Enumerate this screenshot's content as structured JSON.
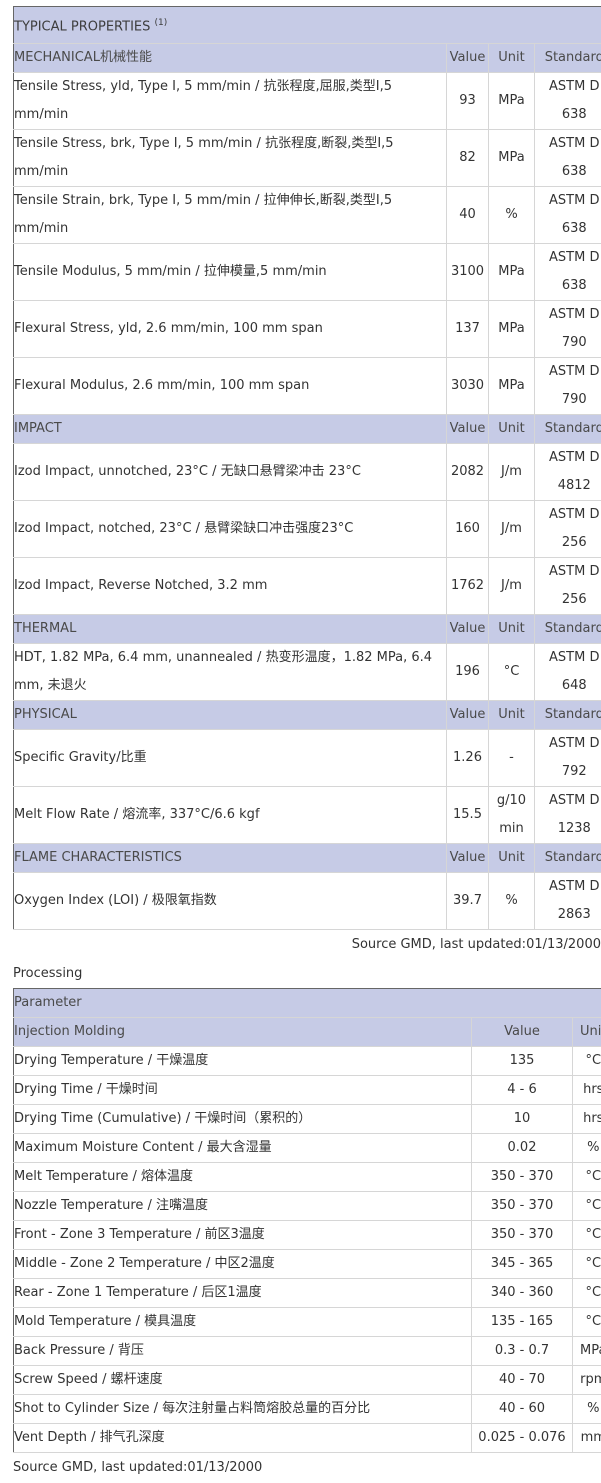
{
  "properties": {
    "title": "TYPICAL PROPERTIES",
    "footnote": "(1)",
    "sections": [
      {
        "name": "MECHANICAL机械性能",
        "value_h": "Value",
        "unit_h": "Unit",
        "std_h": "Standard",
        "rows": [
          {
            "name": "Tensile Stress, yld, Type I, 5 mm/min / 抗张程度,屈服,类型I,5 mm/min",
            "value": "93",
            "unit": "MPa",
            "std1": "ASTM D",
            "std2": "638"
          },
          {
            "name": "Tensile Stress, brk, Type I, 5 mm/min / 抗张程度,断裂,类型I,5 mm/min",
            "value": "82",
            "unit": "MPa",
            "std1": "ASTM D",
            "std2": "638"
          },
          {
            "name": "Tensile Strain, brk, Type I, 5 mm/min / 拉伸伸长,断裂,类型I,5 mm/min",
            "value": "40",
            "unit": "%",
            "std1": "ASTM D",
            "std2": "638"
          },
          {
            "name": "Tensile Modulus, 5 mm/min / 拉伸模量,5 mm/min",
            "value": "3100",
            "unit": "MPa",
            "std1": "ASTM D",
            "std2": "638"
          },
          {
            "name": "Flexural Stress, yld, 2.6 mm/min, 100 mm span",
            "value": "137",
            "unit": "MPa",
            "std1": "ASTM D",
            "std2": "790"
          },
          {
            "name": "Flexural Modulus, 2.6 mm/min, 100 mm span",
            "value": "3030",
            "unit": "MPa",
            "std1": "ASTM D",
            "std2": "790"
          }
        ]
      },
      {
        "name": "IMPACT",
        "value_h": "Value",
        "unit_h": "Unit",
        "std_h": "Standard",
        "rows": [
          {
            "name": "Izod Impact, unnotched, 23°C / 无缺口悬臂梁冲击 23°C",
            "value": "2082",
            "unit": "J/m",
            "std1": "ASTM D",
            "std2": "4812"
          },
          {
            "name": "Izod Impact, notched, 23°C / 悬臂梁缺口冲击强度23°C",
            "value": "160",
            "unit": "J/m",
            "std1": "ASTM D",
            "std2": "256"
          },
          {
            "name": "Izod Impact, Reverse Notched, 3.2 mm",
            "value": "1762",
            "unit": "J/m",
            "std1": "ASTM D",
            "std2": "256"
          }
        ]
      },
      {
        "name": "THERMAL",
        "value_h": "Value",
        "unit_h": "Unit",
        "std_h": "Standard",
        "rows": [
          {
            "name": "HDT, 1.82 MPa, 6.4 mm, unannealed / 热变形温度，1.82 MPa, 6.4 mm, 未退火",
            "value": "196",
            "unit": "°C",
            "std1": "ASTM D",
            "std2": "648"
          }
        ]
      },
      {
        "name": "PHYSICAL",
        "value_h": "Value",
        "unit_h": "Unit",
        "std_h": "Standard",
        "rows": [
          {
            "name": "Specific Gravity/比重",
            "value": "1.26",
            "unit": "-",
            "std1": "ASTM D",
            "std2": "792"
          },
          {
            "name": "Melt Flow Rate / 熔流率, 337°C/6.6 kgf",
            "value": "15.5",
            "unit": "g/10 min",
            "std1": "ASTM D",
            "std2": "1238"
          }
        ]
      },
      {
        "name": "FLAME CHARACTERISTICS",
        "value_h": "Value",
        "unit_h": "Unit",
        "std_h": "Standard",
        "rows": [
          {
            "name": "Oxygen Index (LOI) / 极限氧指数",
            "value": "39.7",
            "unit": "%",
            "std1": "ASTM D",
            "std2": "2863"
          }
        ]
      }
    ],
    "source": "Source GMD, last updated:01/13/2000"
  },
  "processing": {
    "label": "Processing",
    "param_header": "Parameter",
    "group": "Injection Molding",
    "value_h": "Value",
    "unit_h": "Unit",
    "rows": [
      {
        "name": "Drying Temperature / 干燥温度",
        "value": "135",
        "unit": "°C"
      },
      {
        "name": "Drying Time / 干燥时间",
        "value": "4 - 6",
        "unit": "hrs"
      },
      {
        "name": "Drying Time (Cumulative) / 干燥时间（累积的）",
        "value": "10",
        "unit": "hrs"
      },
      {
        "name": "Maximum Moisture Content / 最大含湿量",
        "value": "0.02",
        "unit": "%"
      },
      {
        "name": "Melt Temperature / 熔体温度",
        "value": "350 - 370",
        "unit": "°C"
      },
      {
        "name": "Nozzle Temperature / 注嘴温度",
        "value": "350 - 370",
        "unit": "°C"
      },
      {
        "name": "Front - Zone 3 Temperature / 前区3温度",
        "value": "350 - 370",
        "unit": "°C"
      },
      {
        "name": "Middle - Zone 2 Temperature / 中区2温度",
        "value": "345 - 365",
        "unit": "°C"
      },
      {
        "name": "Rear - Zone 1 Temperature / 后区1温度",
        "value": "340 - 360",
        "unit": "°C"
      },
      {
        "name": "Mold Temperature / 模具温度",
        "value": "135 - 165",
        "unit": "°C"
      },
      {
        "name": "Back Pressure / 背压",
        "value": "0.3 - 0.7",
        "unit": "MPa"
      },
      {
        "name": "Screw Speed / 螺杆速度",
        "value": "40 - 70",
        "unit": "rpm"
      },
      {
        "name": "Shot to Cylinder Size / 每次注射量占料筒熔胶总量的百分比",
        "value": "40 - 60",
        "unit": "%"
      },
      {
        "name": "Vent Depth / 排气孔深度",
        "value": "0.025 - 0.076",
        "unit": "mm"
      }
    ],
    "source": "Source GMD, last updated:01/13/2000"
  }
}
